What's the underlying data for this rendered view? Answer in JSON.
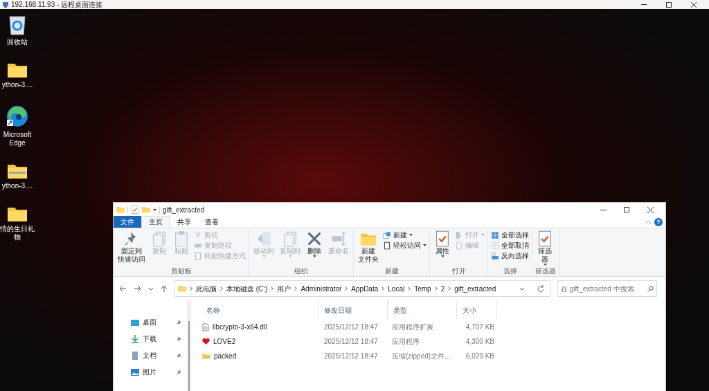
{
  "rdp_window": {
    "title": "192.168.11.93 - 远程桌面连接"
  },
  "desktop": {
    "icons": [
      {
        "label": "回收站",
        "kind": "recycle"
      },
      {
        "label": "ython-3....",
        "kind": "folder"
      },
      {
        "label": "Microsoft Edge",
        "kind": "edge"
      },
      {
        "label": "ython-3....",
        "kind": "zip"
      },
      {
        "label": "情的生日礼物",
        "kind": "folder"
      }
    ]
  },
  "explorer": {
    "title": "gift_extracted",
    "tabs": [
      {
        "label": "文件",
        "kind": "file",
        "selected": false
      },
      {
        "label": "主页",
        "kind": "normal",
        "selected": true
      },
      {
        "label": "共享",
        "kind": "normal",
        "selected": false
      },
      {
        "label": "查看",
        "kind": "normal",
        "selected": false
      }
    ],
    "help": "?",
    "ribbon": [
      {
        "label": "剪贴板",
        "large": [
          {
            "lines": [
              "固定到",
              "快速访问"
            ],
            "kind": "pin",
            "disabled": false,
            "dropdown": false
          },
          {
            "lines": [
              "复制"
            ],
            "kind": "copy",
            "disabled": true,
            "dropdown": false
          },
          {
            "lines": [
              "粘贴"
            ],
            "kind": "paste",
            "disabled": true,
            "dropdown": false
          }
        ],
        "small": [
          {
            "label": "剪切",
            "kind": "cut",
            "disabled": true,
            "dropdown": false
          },
          {
            "label": "复制路径",
            "kind": "path",
            "disabled": true,
            "dropdown": false
          },
          {
            "label": "粘贴快捷方式",
            "kind": "shortcut",
            "disabled": true,
            "dropdown": false
          }
        ]
      },
      {
        "label": "组织",
        "large": [
          {
            "lines": [
              "移动到"
            ],
            "kind": "move",
            "disabled": true,
            "dropdown": true
          },
          {
            "lines": [
              "复制到"
            ],
            "kind": "copyto",
            "disabled": true,
            "dropdown": true
          },
          {
            "lines": [
              "删除"
            ],
            "kind": "delete",
            "disabled": false,
            "dropdown": true
          },
          {
            "lines": [
              "重命名"
            ],
            "kind": "rename",
            "disabled": true,
            "dropdown": false
          }
        ]
      },
      {
        "label": "新建",
        "large": [
          {
            "lines": [
              "新建",
              "文件夹"
            ],
            "kind": "folder",
            "disabled": false,
            "dropdown": false
          }
        ],
        "small": [
          {
            "label": "新建",
            "kind": "newitem",
            "disabled": false,
            "dropdown": true
          },
          {
            "label": "轻松访问",
            "kind": "easy",
            "disabled": false,
            "dropdown": true
          }
        ]
      },
      {
        "label": "打开",
        "large": [
          {
            "lines": [
              "属性"
            ],
            "kind": "props",
            "disabled": false,
            "dropdown": true
          }
        ],
        "small": [
          {
            "label": "打开",
            "kind": "open",
            "disabled": true,
            "dropdown": true
          },
          {
            "label": "编辑",
            "kind": "edit",
            "disabled": true,
            "dropdown": false
          }
        ]
      },
      {
        "label": "选择",
        "small": [
          {
            "label": "全部选择",
            "kind": "selall",
            "disabled": false,
            "dropdown": false
          },
          {
            "label": "全部取消",
            "kind": "selnone",
            "disabled": false,
            "dropdown": false
          },
          {
            "label": "反向选择",
            "kind": "selinv",
            "disabled": false,
            "dropdown": false
          }
        ]
      },
      {
        "label": "筛选器",
        "large": [
          {
            "lines": [
              "筛选",
              "器"
            ],
            "kind": "props",
            "disabled": false,
            "dropdown": true
          }
        ]
      }
    ],
    "path": [
      "此电脑",
      "本地磁盘 (C:)",
      "用户",
      "Administrator",
      "AppData",
      "Local",
      "Temp",
      "2",
      "gift_extracted"
    ],
    "search": {
      "placeholder": "在 gift_extracted 中搜索"
    },
    "nav": [
      {
        "label": "桌面",
        "kind": "desktop",
        "pinned": true
      },
      {
        "label": "下载",
        "kind": "download",
        "pinned": true
      },
      {
        "label": "文档",
        "kind": "docs",
        "pinned": true
      },
      {
        "label": "图片",
        "kind": "pictures",
        "pinned": true
      }
    ],
    "columns": [
      "名称",
      "修改日期",
      "类型",
      "大小"
    ],
    "rows": [
      {
        "name": "libcrypto-3-x64.dll",
        "kind": "dll",
        "date": "2025/12/12 18:47",
        "type": "应用程序扩展",
        "size": "4,707 KB"
      },
      {
        "name": "LOVE2",
        "kind": "heart",
        "date": "2025/12/12 18:47",
        "type": "应用程序",
        "size": "4,300 KB"
      },
      {
        "name": "packed",
        "kind": "zip",
        "date": "2025/12/12 18:47",
        "type": "压缩(zipped)文件...",
        "size": "6,029 KB"
      }
    ]
  }
}
